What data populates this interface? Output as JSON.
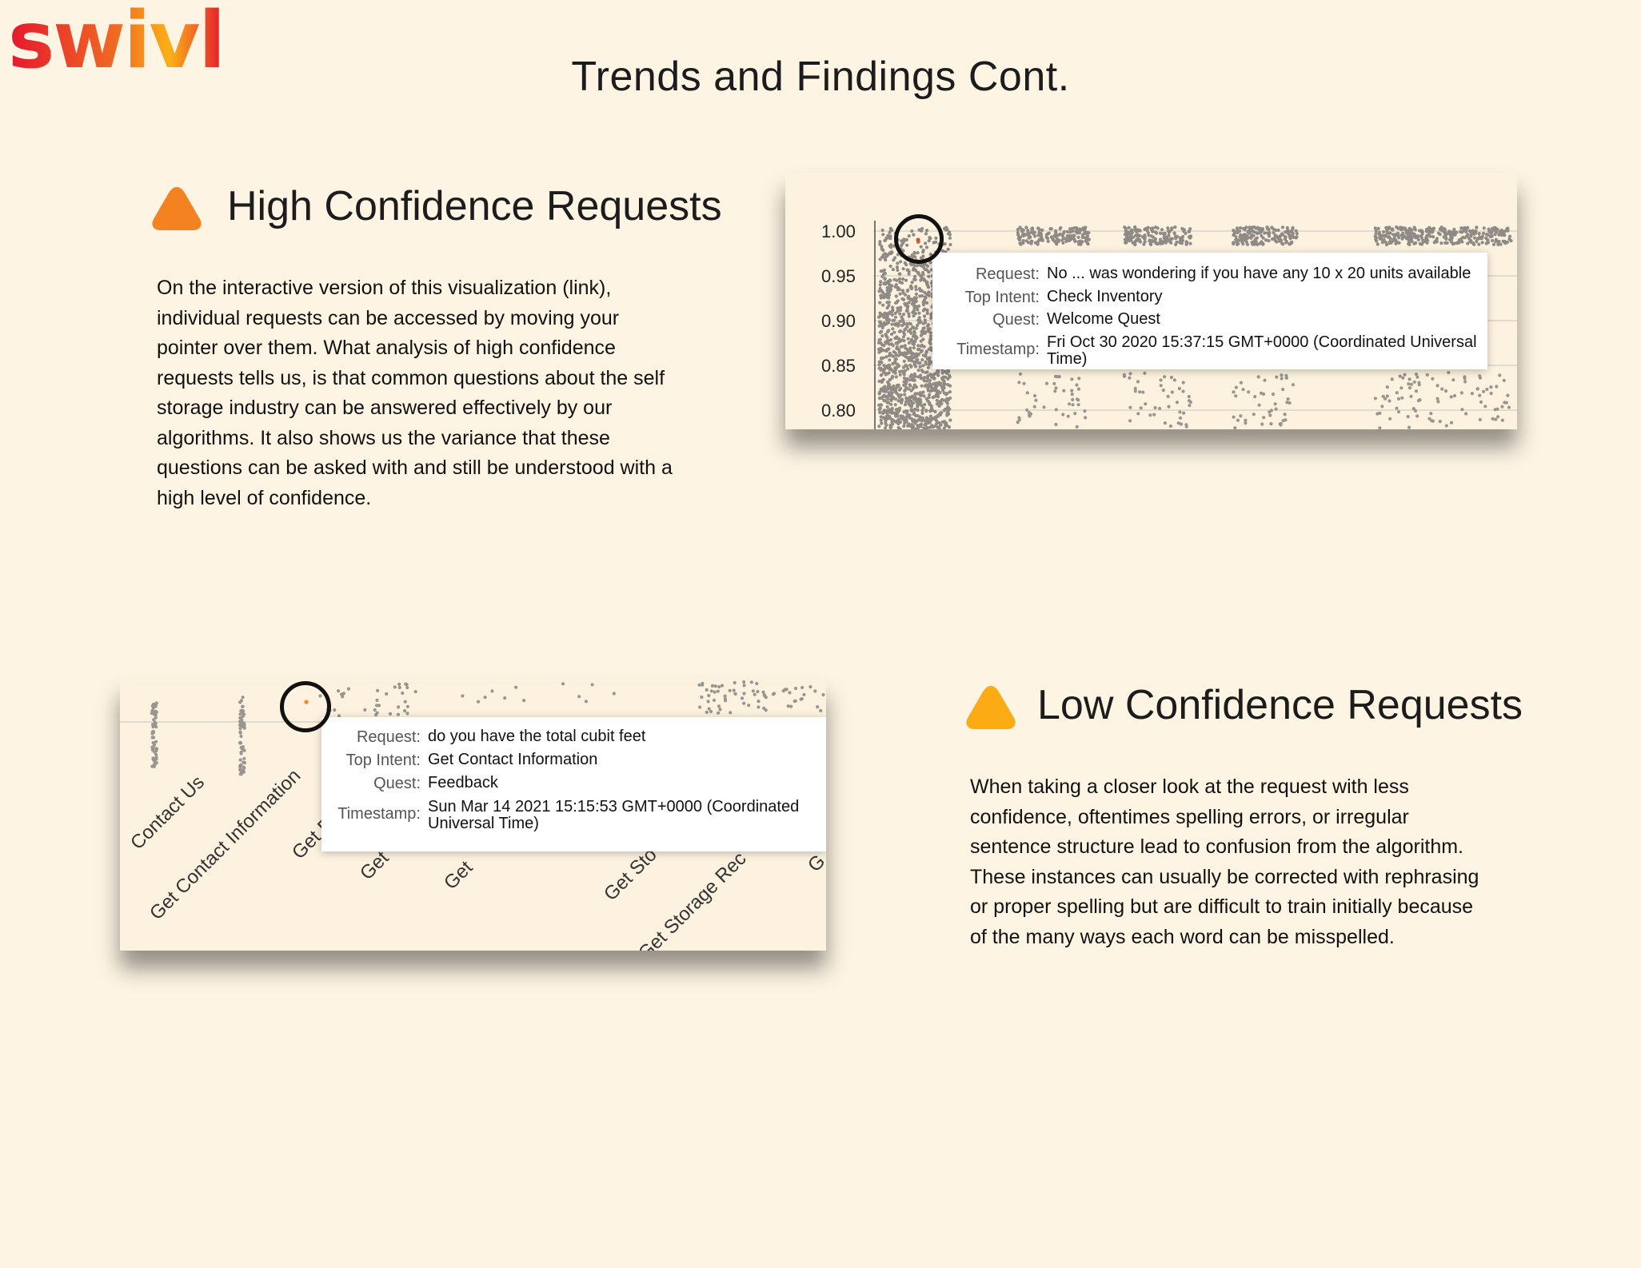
{
  "logo": {
    "text": "swivl",
    "colors": [
      "#e5172f",
      "#f57a1f",
      "#fbb116"
    ]
  },
  "page_title": "Trends and Findings Cont.",
  "high": {
    "heading": "High Confidence Requests",
    "icon": "orange-triangle-icon",
    "lines": [
      "On the interactive version of this visualization (link),",
      "individual requests can be accessed by moving your",
      "pointer over them. What analysis of high confidence",
      "requests tells us, is that common questions about the self",
      "storage industry can be answered effectively by our",
      "algorithms. It also shows us the variance that these",
      "questions can be asked with and still be understood with a",
      "high level of confidence."
    ],
    "screenshot": {
      "y_ticks": [
        "1.00",
        "0.95",
        "0.90",
        "0.85",
        "0.80"
      ],
      "tooltip": {
        "request_label": "Request:",
        "request": "No ... was wondering if you have any 10 x 20 units available",
        "intent_label": "Top Intent:",
        "intent": "Check Inventory",
        "quest_label": "Quest:",
        "quest": "Welcome Quest",
        "timestamp_label": "Timestamp:",
        "timestamp_line1": "Fri Oct 30 2020 15:37:15 GMT+0000 (Coordinated Universal",
        "timestamp_line2": "Time)"
      }
    }
  },
  "low": {
    "heading": "Low Confidence Requests",
    "icon": "yellow-triangle-icon",
    "lines": [
      "When taking a closer look at the request with less",
      "confidence, oftentimes spelling errors, or irregular",
      "sentence structure lead to confusion from the algorithm.",
      "These instances can usually be corrected with rephrasing",
      "or proper spelling but are difficult to train initially because",
      "of the many ways each word can be misspelled."
    ],
    "screenshot": {
      "x_ticks": [
        "Contact Us",
        "Get Contact Information",
        "Get Di",
        "Get",
        "Get",
        "Get Sto",
        "Get Storage Rec",
        "G"
      ],
      "tooltip": {
        "request_label": "Request:",
        "request": "do you have the total cubit feet",
        "intent_label": "Top Intent:",
        "intent": "Get Contact Information",
        "quest_label": "Quest:",
        "quest": "Feedback",
        "timestamp_label": "Timestamp:",
        "timestamp_line1": "Sun Mar 14 2021 15:15:53 GMT+0000 (Coordinated",
        "timestamp_line2": "Universal Time)"
      }
    }
  }
}
